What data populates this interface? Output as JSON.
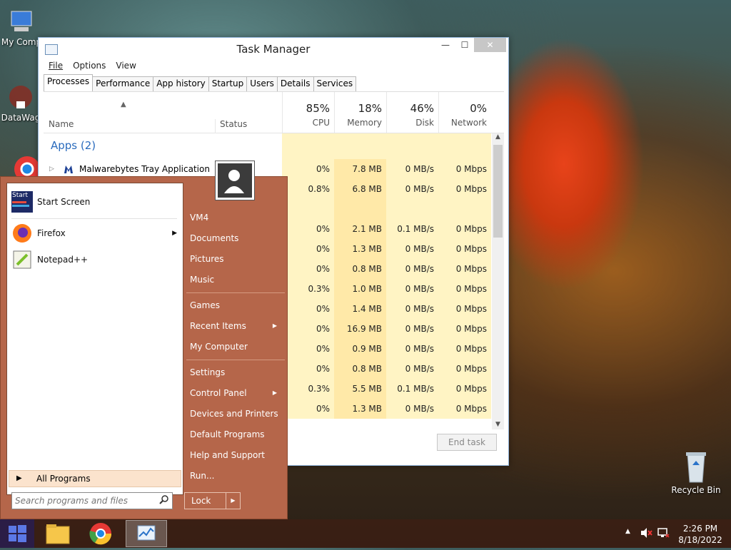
{
  "desktop": {
    "icons": [
      {
        "label": "My Comp",
        "icon": "computer-icon"
      },
      {
        "label": "DataWag",
        "icon": "shortcut-icon"
      },
      {
        "label": "Recycle Bin",
        "icon": "recycle-bin-icon"
      }
    ]
  },
  "task_manager": {
    "title": "Task Manager",
    "menu": [
      "File",
      "Options",
      "View"
    ],
    "tabs": [
      "Processes",
      "Performance",
      "App history",
      "Startup",
      "Users",
      "Details",
      "Services"
    ],
    "active_tab": "Processes",
    "columns": {
      "name": "Name",
      "status": "Status",
      "cpu": {
        "pct": "85%",
        "label": "CPU"
      },
      "memory": {
        "pct": "18%",
        "label": "Memory"
      },
      "disk": {
        "pct": "46%",
        "label": "Disk"
      },
      "network": {
        "pct": "0%",
        "label": "Network"
      }
    },
    "group": "Apps (2)",
    "rows": [
      {
        "name": "Malwarebytes Tray Application",
        "cpu": "0%",
        "mem": "7.8 MB",
        "disk": "0 MB/s",
        "net": "0 Mbps"
      },
      {
        "name": "",
        "cpu": "0.8%",
        "mem": "6.8 MB",
        "disk": "0 MB/s",
        "net": "0 Mbps"
      },
      {
        "name": "",
        "cpu": "",
        "mem": "",
        "disk": "",
        "net": ""
      },
      {
        "name": "",
        "cpu": "0%",
        "mem": "2.1 MB",
        "disk": "0.1 MB/s",
        "net": "0 Mbps"
      },
      {
        "name": "",
        "cpu": "0%",
        "mem": "1.3 MB",
        "disk": "0 MB/s",
        "net": "0 Mbps"
      },
      {
        "name": "",
        "cpu": "0%",
        "mem": "0.8 MB",
        "disk": "0 MB/s",
        "net": "0 Mbps"
      },
      {
        "name": "",
        "cpu": "0.3%",
        "mem": "1.0 MB",
        "disk": "0 MB/s",
        "net": "0 Mbps"
      },
      {
        "name": "",
        "cpu": "0%",
        "mem": "1.4 MB",
        "disk": "0 MB/s",
        "net": "0 Mbps"
      },
      {
        "name": "",
        "cpu": "0%",
        "mem": "16.9 MB",
        "disk": "0 MB/s",
        "net": "0 Mbps"
      },
      {
        "name": "",
        "cpu": "0%",
        "mem": "0.9 MB",
        "disk": "0 MB/s",
        "net": "0 Mbps"
      },
      {
        "name": "",
        "cpu": "0%",
        "mem": "0.8 MB",
        "disk": "0 MB/s",
        "net": "0 Mbps"
      },
      {
        "name": "",
        "cpu": "0.3%",
        "mem": "5.5 MB",
        "disk": "0.1 MB/s",
        "net": "0 Mbps"
      },
      {
        "name": "",
        "cpu": "0%",
        "mem": "1.3 MB",
        "disk": "0 MB/s",
        "net": "0 Mbps"
      }
    ],
    "end_task": "End task"
  },
  "start_menu": {
    "programs": [
      "Start Screen",
      "Firefox",
      "Notepad++"
    ],
    "all_programs": "All Programs",
    "search_placeholder": "Search programs and files",
    "start_tile": "Start",
    "right_items": [
      "VM4",
      "Documents",
      "Pictures",
      "Music",
      "Games",
      "Recent Items",
      "My Computer",
      "Settings",
      "Control Panel",
      "Devices and Printers",
      "Default Programs",
      "Help and Support",
      "Run..."
    ],
    "lock": "Lock"
  },
  "taskbar": {
    "time": "2:26 PM",
    "date": "8/18/2022"
  }
}
